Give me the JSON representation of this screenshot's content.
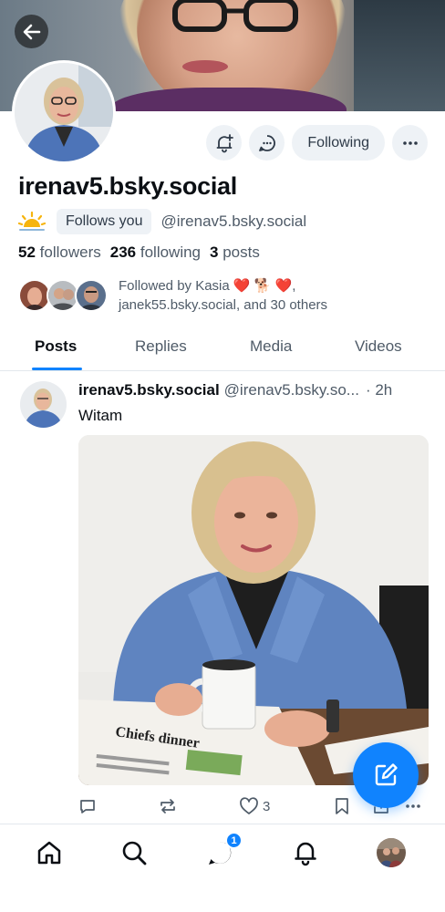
{
  "profile": {
    "display_name": "irenav5.bsky.social",
    "follows_you_label": "Follows you",
    "handle": "@irenav5.bsky.social",
    "followers_count": "52",
    "followers_label": "followers",
    "following_count": "236",
    "following_label": "following",
    "posts_count": "3",
    "posts_label": "posts",
    "followed_by_line1": "Followed by Kasia ❤️ 🐕 ❤️,",
    "followed_by_line2": "janek55.bsky.social, and 30 others",
    "status_emoji_icon": "sun-icon"
  },
  "actions": {
    "following_label": "Following"
  },
  "tabs": [
    {
      "label": "Posts"
    },
    {
      "label": "Replies"
    },
    {
      "label": "Media"
    },
    {
      "label": "Videos"
    }
  ],
  "post": {
    "author": "irenav5.bsky.social",
    "handle": "@irenav5.bsky.so...",
    "time": "· 2h",
    "text": "Witam",
    "like_count": "3",
    "image_newspaper_text": "Chiefs dinner"
  },
  "nav": {
    "chat_badge": "1"
  },
  "colors": {
    "accent": "#1083fe",
    "muted_text": "#4f5b68",
    "chip_bg": "#eef2f6"
  }
}
